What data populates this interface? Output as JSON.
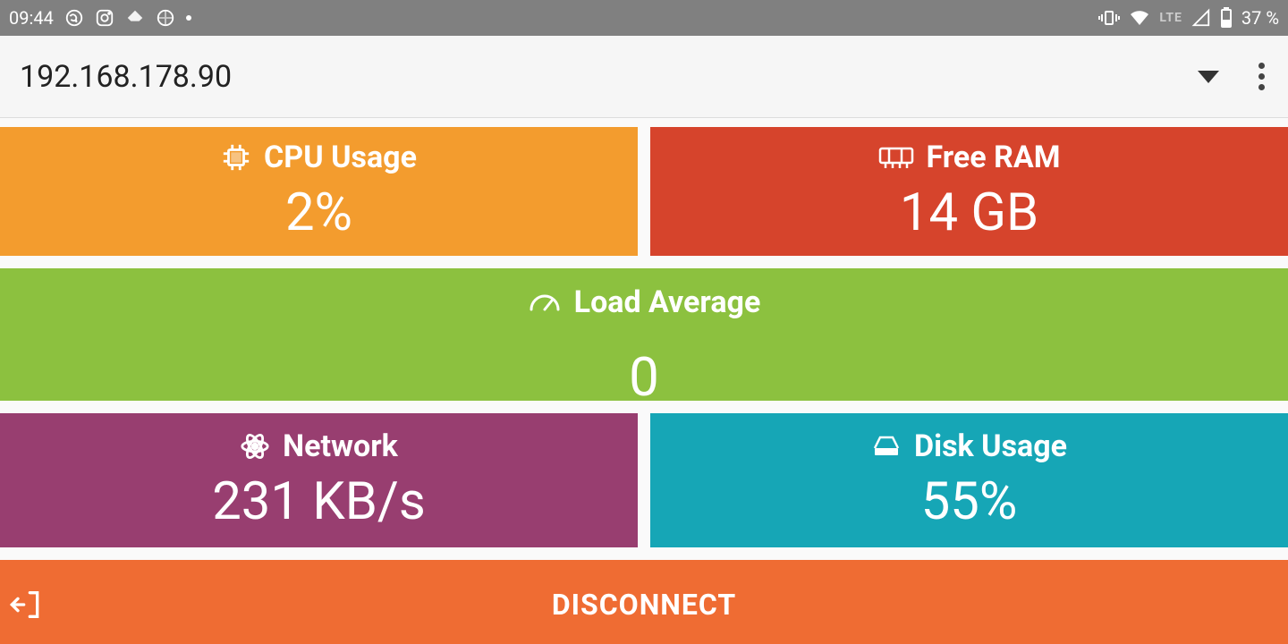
{
  "status": {
    "time": "09:44",
    "battery": "37 %",
    "lte": "LTE"
  },
  "appbar": {
    "title": "192.168.178.90"
  },
  "tiles": {
    "cpu": {
      "label": "CPU Usage",
      "value": "2%"
    },
    "ram": {
      "label": "Free RAM",
      "value": "14 GB"
    },
    "load": {
      "label": "Load Average",
      "value": "0"
    },
    "net": {
      "label": "Network",
      "value": "231 KB/s"
    },
    "disk": {
      "label": "Disk Usage",
      "value": "55%"
    }
  },
  "disconnect": {
    "label": "DISCONNECT"
  },
  "colors": {
    "orange": "#f39c2e",
    "red": "#d6442c",
    "green": "#8cc13f",
    "purple": "#983e70",
    "teal": "#16a6b6",
    "disconnect": "#ef6c33"
  }
}
